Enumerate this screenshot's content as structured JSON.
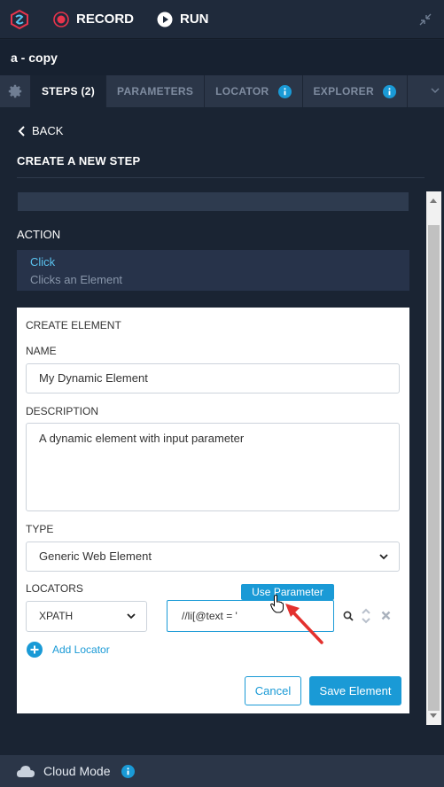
{
  "topbar": {
    "record_label": "RECORD",
    "run_label": "RUN"
  },
  "title": "a - copy",
  "tabs": [
    {
      "label": "STEPS (2)",
      "active": true
    },
    {
      "label": "PARAMETERS"
    },
    {
      "label": "LOCATOR"
    },
    {
      "label": "EXPLORER"
    }
  ],
  "back_label": "BACK",
  "heading": "CREATE A NEW STEP",
  "action": {
    "label": "ACTION",
    "name": "Click",
    "description": "Clicks an Element"
  },
  "form": {
    "section_title": "CREATE ELEMENT",
    "name_label": "NAME",
    "name_value": "My Dynamic Element",
    "description_label": "DESCRIPTION",
    "description_value": "A dynamic element with input parameter",
    "type_label": "TYPE",
    "type_value": "Generic Web Element",
    "locators_label": "LOCATORS",
    "locator_type": "XPATH",
    "locator_value": "//li[@text = '",
    "tooltip": "Use Parameter",
    "add_locator": "Add Locator",
    "cancel": "Cancel",
    "save": "Save Element"
  },
  "footer": {
    "mode": "Cloud Mode"
  },
  "colors": {
    "accent": "#1a9ad6",
    "record": "#e8344c",
    "background": "#1a2433"
  }
}
